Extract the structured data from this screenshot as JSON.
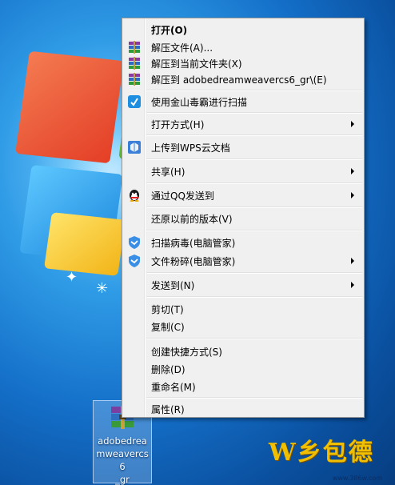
{
  "desktop": {
    "file_icon": {
      "name": "adobedreamweavercs6_gr",
      "label_lines": "adobedrea\nmweavercs6\n_gr"
    }
  },
  "watermark": {
    "text": "W乡包德",
    "url": "www.386w.com"
  },
  "context_menu": {
    "items": [
      {
        "label": "打开(O)",
        "bold": true,
        "icon": null
      },
      {
        "label": "解压文件(A)...",
        "icon": "winrar-icon"
      },
      {
        "label": "解压到当前文件夹(X)",
        "icon": "winrar-icon"
      },
      {
        "label": "解压到 adobedreamweavercs6_gr\\(E)",
        "icon": "winrar-icon"
      },
      {
        "label": "使用金山毒霸进行扫描",
        "icon": "kingsoft-antivirus-icon"
      },
      {
        "label": "打开方式(H)",
        "icon": null,
        "submenu": true
      },
      {
        "label": "上传到WPS云文档",
        "icon": "wps-cloud-icon"
      },
      {
        "label": "共享(H)",
        "icon": null,
        "submenu": true
      },
      {
        "label": "通过QQ发送到",
        "icon": "qq-penguin-icon",
        "submenu": true
      },
      {
        "label": "还原以前的版本(V)",
        "icon": null
      },
      {
        "label": "扫描病毒(电脑管家)",
        "icon": "tencent-pc-manager-icon"
      },
      {
        "label": "文件粉碎(电脑管家)",
        "icon": "tencent-pc-manager-icon",
        "submenu": true
      },
      {
        "label": "发送到(N)",
        "icon": null,
        "submenu": true
      },
      {
        "label": "剪切(T)",
        "icon": null
      },
      {
        "label": "复制(C)",
        "icon": null
      },
      {
        "label": "创建快捷方式(S)",
        "icon": null
      },
      {
        "label": "删除(D)",
        "icon": null
      },
      {
        "label": "重命名(M)",
        "icon": null
      },
      {
        "label": "属性(R)",
        "icon": null
      }
    ]
  },
  "colors": {
    "menu_bg": "#f0f0f0",
    "menu_border": "#979797",
    "desktop_blue": "#146fc8",
    "qq_icon_bg": "#1a1a1a",
    "tencent_blue": "#3a8ee6"
  }
}
